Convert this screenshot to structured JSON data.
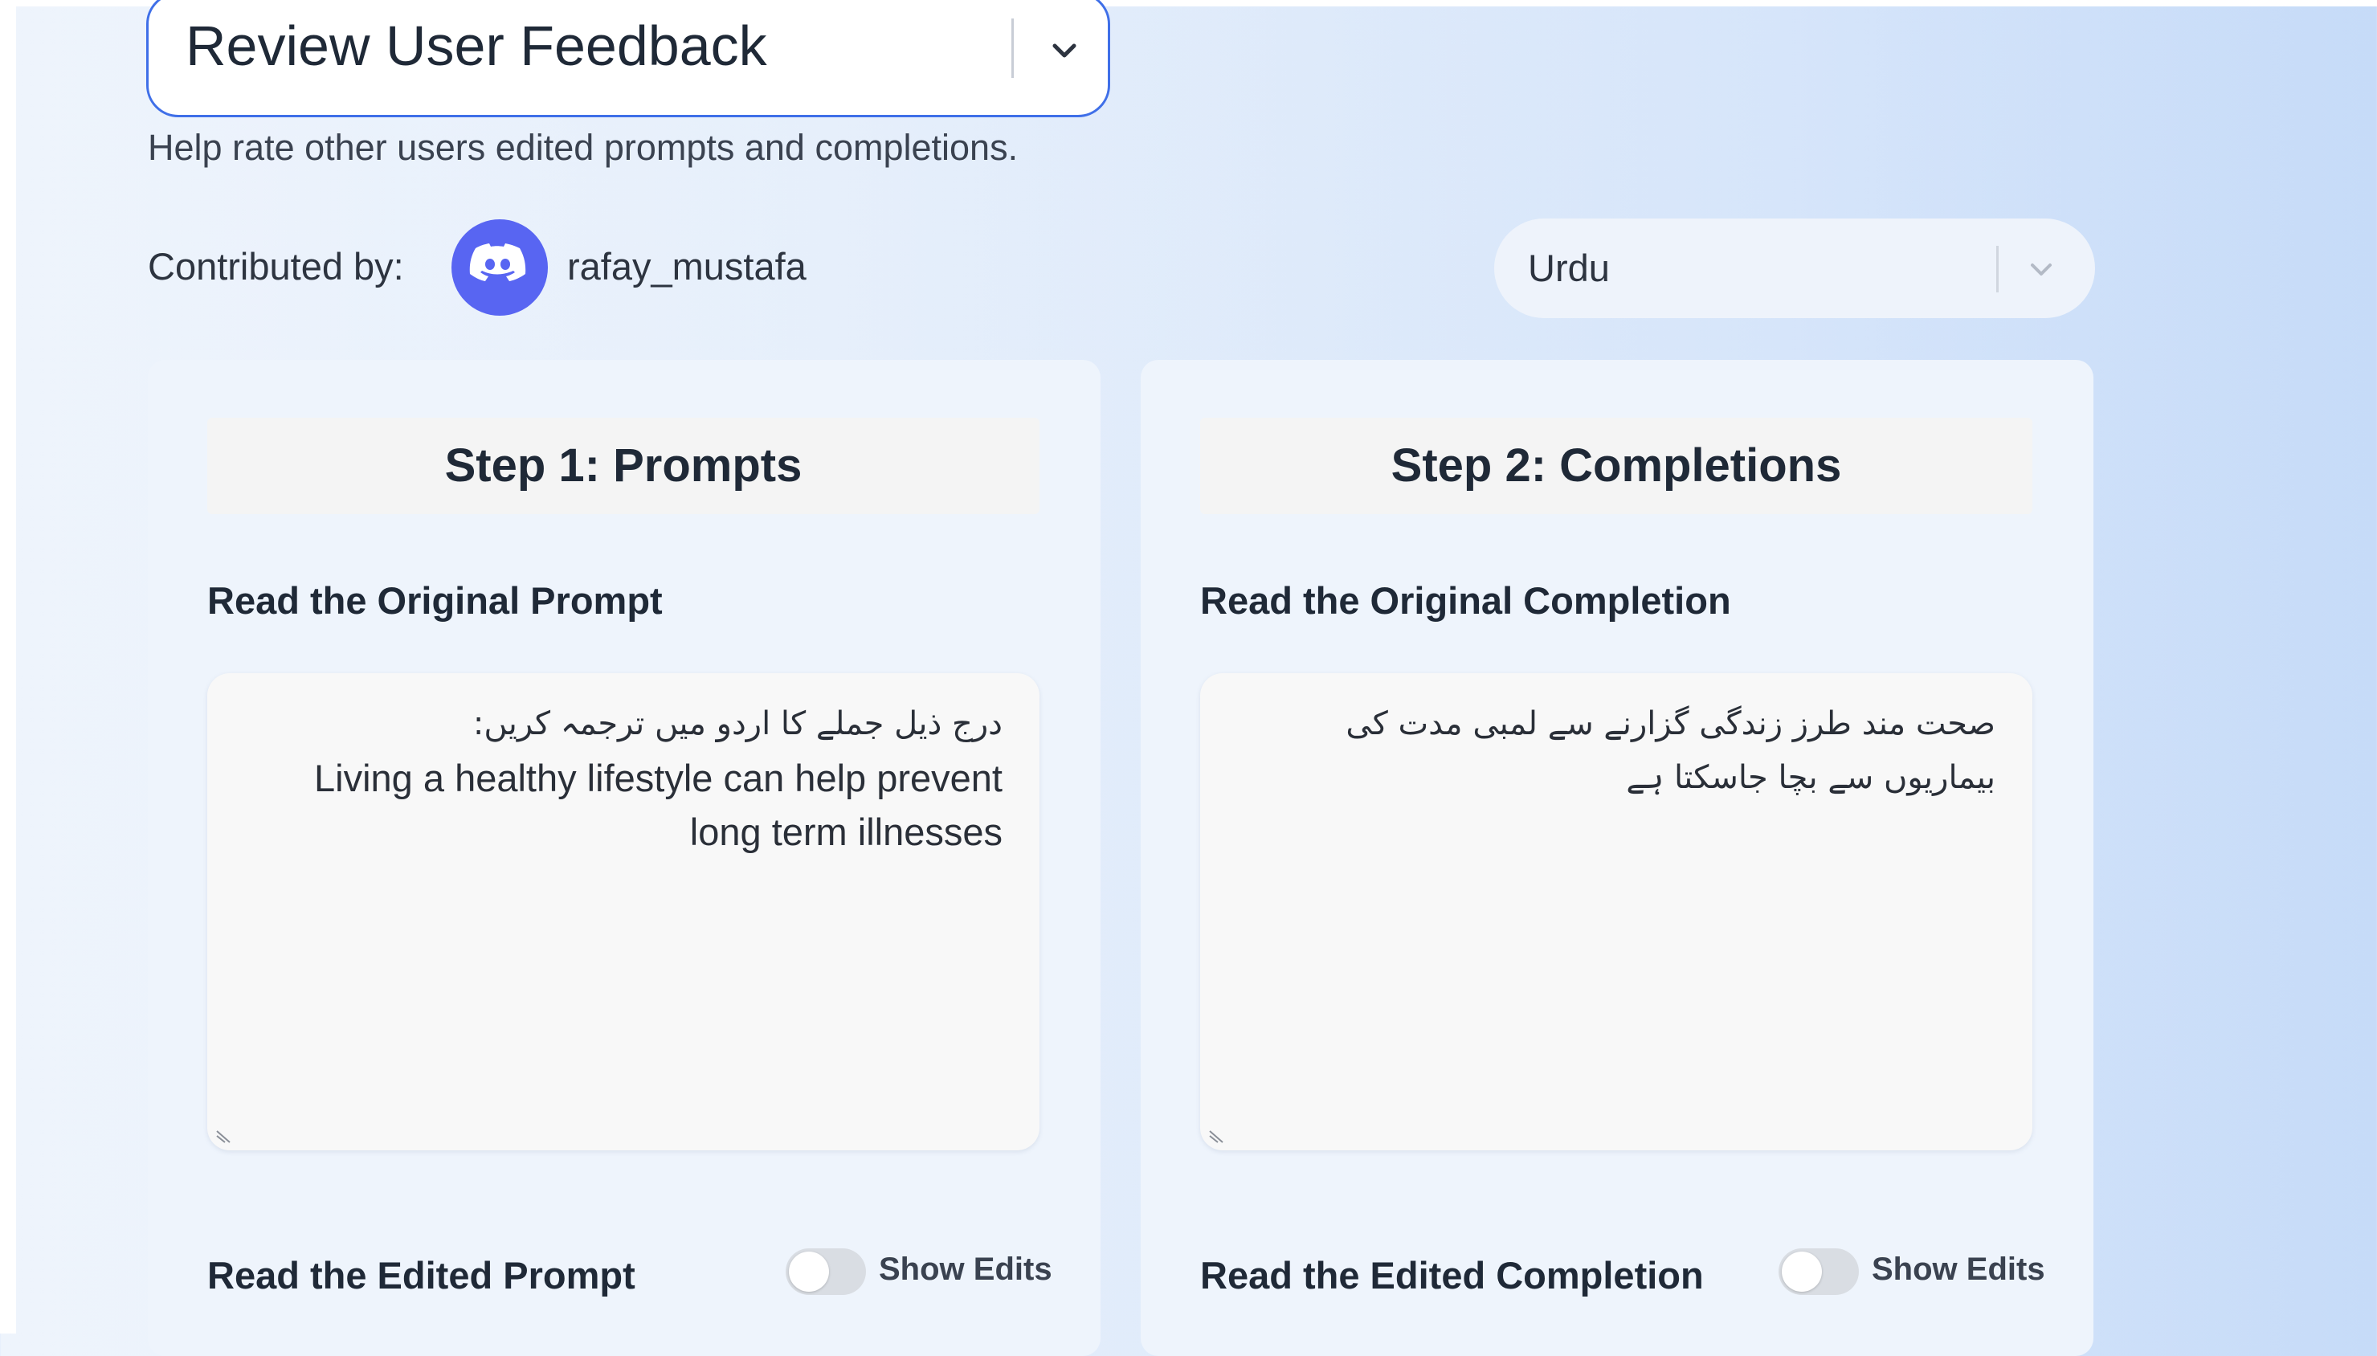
{
  "mode_select": {
    "value": "Review User Feedback"
  },
  "subtitle": "Help rate other users edited prompts and completions.",
  "contributor": {
    "label": "Contributed by:",
    "username": "rafay_mustafa"
  },
  "language_select": {
    "value": "Urdu"
  },
  "prompts_card": {
    "header": "Step 1: Prompts",
    "original_title": "Read the Original Prompt",
    "original_text": {
      "line1": "درج ذیل جملے کا اردو میں ترجمہ کریں:",
      "line2": "Living a healthy lifestyle can help prevent",
      "line3": "long term illnesses"
    },
    "edited_title": "Read the Edited Prompt",
    "show_edits_label": "Show Edits",
    "show_edits_on": false
  },
  "completions_card": {
    "header": "Step 2: Completions",
    "original_title": "Read the Original Completion",
    "original_text": {
      "line1": "صحت مند طرز زندگی گزارنے سے لمبی مدت کی",
      "line2": "بیماریوں سے بچا جاسکتا ہے"
    },
    "edited_title": "Read the Edited Completion",
    "show_edits_label": "Show Edits",
    "show_edits_on": false
  },
  "colors": {
    "accent_border": "#3f6fe8",
    "discord": "#5865f2",
    "toggle_off": "#d9dde3"
  },
  "icons": {
    "mode_chevron": "chevron-down-icon",
    "avatar": "discord-icon",
    "language_chevron": "chevron-down-icon",
    "resize": "resize-handle-icon"
  }
}
